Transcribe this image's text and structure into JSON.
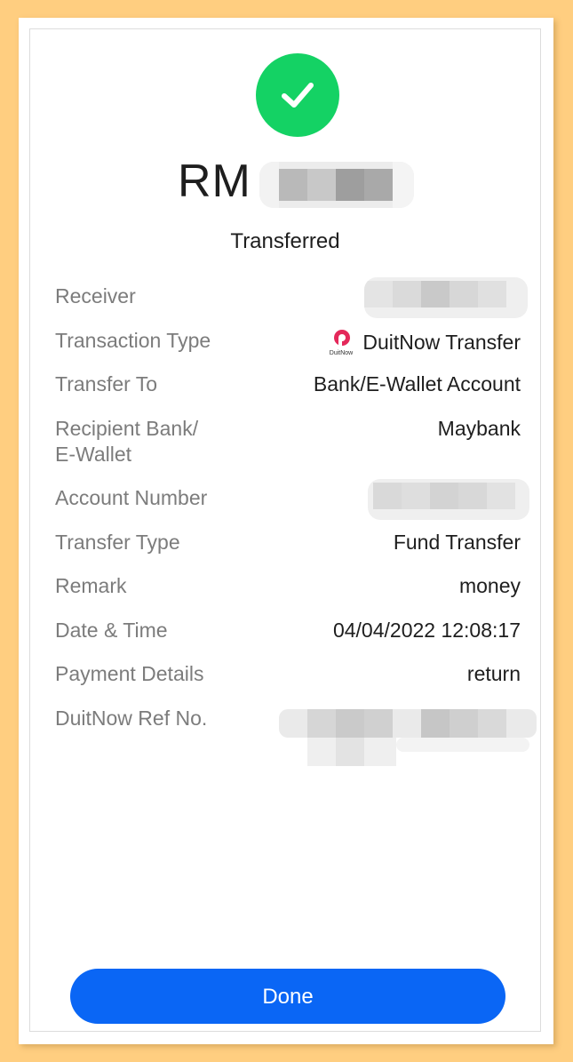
{
  "header": {
    "currency": "RM",
    "status": "Transferred"
  },
  "details": {
    "receiver_label": "Receiver",
    "transaction_type_label": "Transaction Type",
    "transaction_type_value": "DuitNow Transfer",
    "duitnow_logo_text": "DuitNow",
    "transfer_to_label": "Transfer To",
    "transfer_to_value": "Bank/E-Wallet Account",
    "recipient_bank_label_1": "Recipient Bank/",
    "recipient_bank_label_2": "E-Wallet",
    "recipient_bank_value": "Maybank",
    "account_number_label": "Account Number",
    "transfer_type_label": "Transfer Type",
    "transfer_type_value": "Fund Transfer",
    "remark_label": "Remark",
    "remark_value": "money",
    "datetime_label": "Date & Time",
    "datetime_value": "04/04/2022 12:08:17",
    "payment_details_label": "Payment Details",
    "payment_details_value": "return",
    "ref_label": "DuitNow Ref No."
  },
  "actions": {
    "done_label": "Done"
  },
  "colors": {
    "success": "#14d264",
    "primary": "#0a66f5",
    "background": "#ffce80",
    "duitnow_brand": "#e4285a"
  }
}
